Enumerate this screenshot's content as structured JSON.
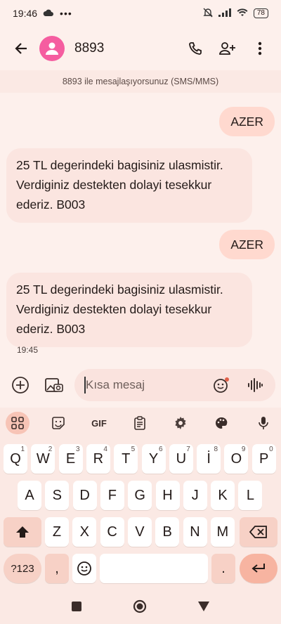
{
  "status_bar": {
    "time": "19:46",
    "battery": "78"
  },
  "header": {
    "contact": "8893"
  },
  "banner": "8893 ile mesajlaşıyorsunuz (SMS/MMS)",
  "messages": [
    {
      "dir": "out",
      "text": "AZER"
    },
    {
      "dir": "in",
      "lines": [
        "25 TL degerindeki bagisiniz ulasmistir.",
        "Verdiginiz destekten dolayi tesekkur",
        "ederiz. B003"
      ]
    },
    {
      "dir": "out",
      "text": "AZER"
    },
    {
      "dir": "in",
      "lines": [
        "25 TL degerindeki bagisiniz ulasmistir.",
        "Verdiginiz destekten dolayi tesekkur",
        "ederiz. B003"
      ]
    }
  ],
  "timestamp": "19:45",
  "composer": {
    "placeholder": "Kısa mesaj"
  },
  "keyboard": {
    "toolbar": {
      "gif": "GIF"
    },
    "row1": [
      {
        "k": "Q",
        "h": "1"
      },
      {
        "k": "W",
        "h": "2"
      },
      {
        "k": "E",
        "h": "3"
      },
      {
        "k": "R",
        "h": "4"
      },
      {
        "k": "T",
        "h": "5"
      },
      {
        "k": "Y",
        "h": "6"
      },
      {
        "k": "U",
        "h": "7"
      },
      {
        "k": "İ",
        "h": "8"
      },
      {
        "k": "O",
        "h": "9"
      },
      {
        "k": "P",
        "h": "0"
      }
    ],
    "row2": [
      "A",
      "S",
      "D",
      "F",
      "G",
      "H",
      "J",
      "K",
      "L"
    ],
    "row3": [
      "Z",
      "X",
      "C",
      "V",
      "B",
      "N",
      "M"
    ],
    "symbols": "?123",
    "comma": ",",
    "period": "."
  },
  "colors": {
    "accent": "#f7b4a1",
    "avatar": "#f55da0",
    "bubble_out": "#ffd9cf",
    "bubble_in": "#fbe5e0"
  }
}
